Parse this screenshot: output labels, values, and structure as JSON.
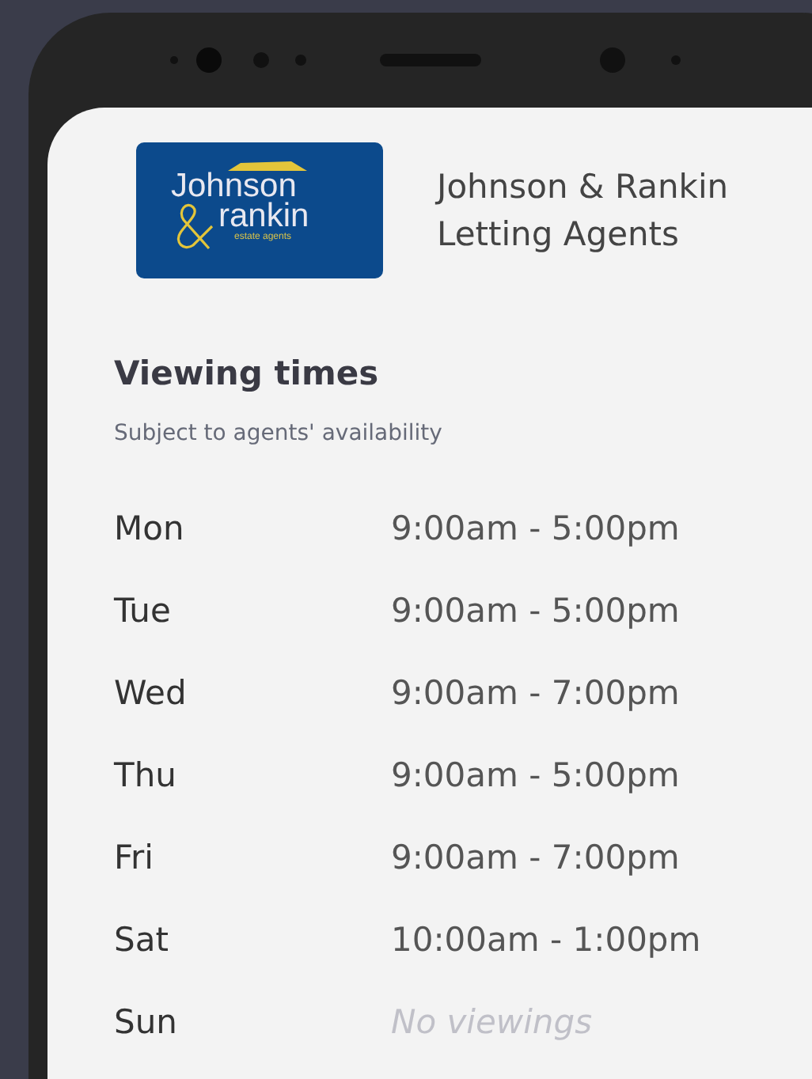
{
  "logo": {
    "line_1": "Johnson",
    "line_2": "rankin",
    "tagline": "estate agents"
  },
  "agent": {
    "name": "Johnson & Rankin",
    "type": "Letting Agents"
  },
  "viewing": {
    "title": "Viewing times",
    "note": "Subject to agents' availability",
    "days": [
      {
        "day": "Mon",
        "kind": "hours",
        "hours": "9:00am - 5:00pm"
      },
      {
        "day": "Tue",
        "kind": "hours",
        "hours": "9:00am - 5:00pm"
      },
      {
        "day": "Wed",
        "kind": "hours",
        "hours": "9:00am - 7:00pm"
      },
      {
        "day": "Thu",
        "kind": "hours",
        "hours": "9:00am - 5:00pm"
      },
      {
        "day": "Fri",
        "kind": "hours",
        "hours": "9:00am - 7:00pm"
      },
      {
        "day": "Sat",
        "kind": "hours",
        "hours": "10:00am - 1:00pm"
      },
      {
        "day": "Sun",
        "kind": "none",
        "hours": "No viewings"
      }
    ]
  }
}
